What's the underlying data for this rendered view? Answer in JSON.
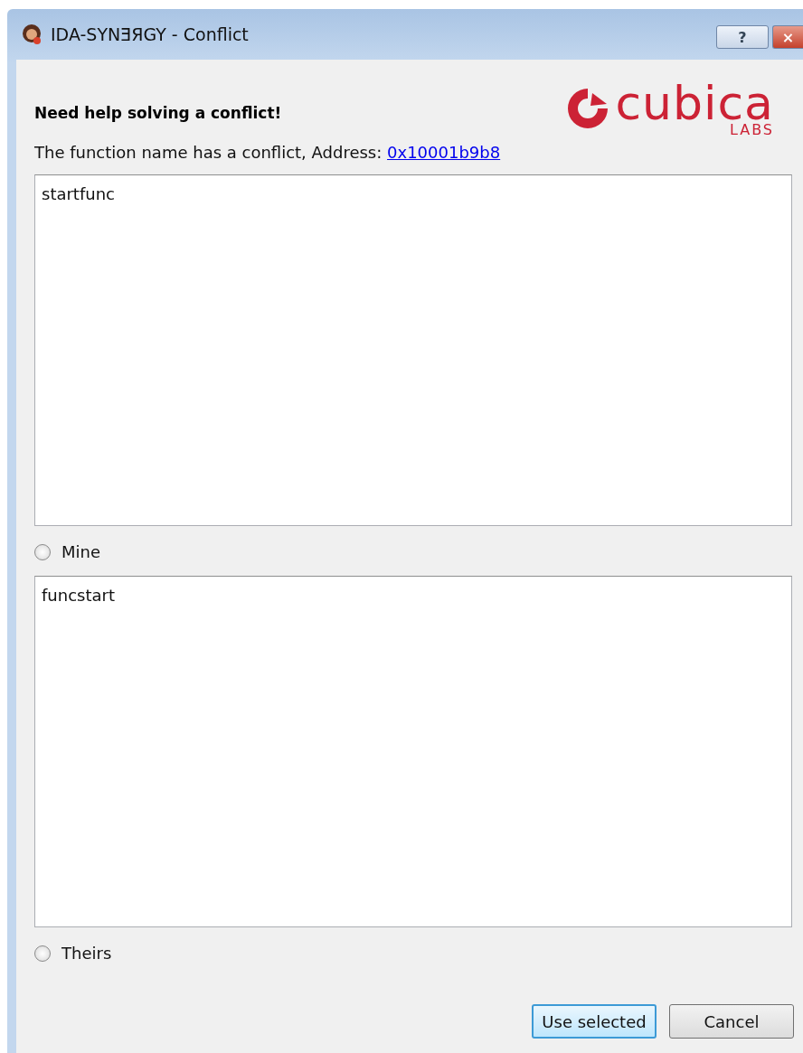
{
  "window": {
    "title": "IDA-SYNƎЯGY - Conflict",
    "help_button": "?",
    "close_button": "×"
  },
  "heading": "Need help solving a conflict!",
  "logo": {
    "name": "cubica",
    "sub": "LABS"
  },
  "message": {
    "text": "The function name has a conflict, Address: ",
    "link": "0x10001b9b8"
  },
  "text_areas": [
    {
      "value": "startfunc"
    },
    {
      "value": "funcstart"
    }
  ],
  "options": [
    {
      "label": "Mine",
      "selected": false
    },
    {
      "label": "Theirs",
      "selected": false
    }
  ],
  "buttons": [
    {
      "label": "Use selected",
      "default": true
    },
    {
      "label": "Cancel",
      "default": false
    }
  ]
}
